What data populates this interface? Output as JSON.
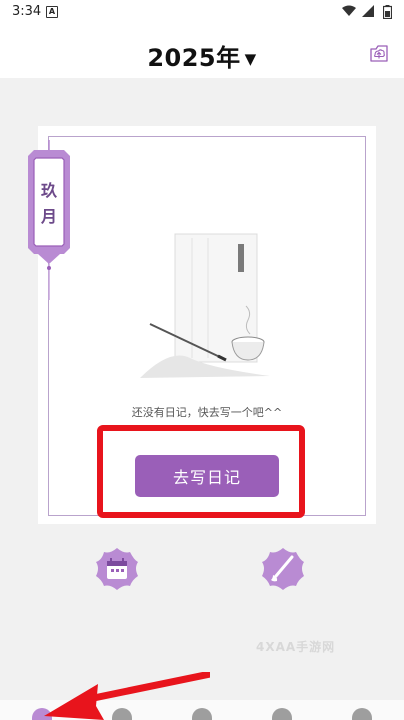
{
  "status_bar": {
    "time": "3:34",
    "sim_badge": "A"
  },
  "header": {
    "year": "2025年",
    "dropdown_caret": "▼",
    "upload_icon": "cloud-upload-icon"
  },
  "month_tag": {
    "label": "玖\n月"
  },
  "empty_state": {
    "message": "还没有日记，快去写一个吧^^",
    "button_label": "去写日记"
  },
  "actions": {
    "calendar_icon": "calendar-icon",
    "brush_icon": "brush-icon"
  },
  "watermark": "4XAA手游网",
  "bottom_nav": {
    "items": [
      "nav-home",
      "nav-2",
      "nav-3",
      "nav-4",
      "nav-5"
    ]
  },
  "colors": {
    "accent": "#9a5fb8",
    "highlight": "#e8141c",
    "frame": "#b9a3cc"
  }
}
